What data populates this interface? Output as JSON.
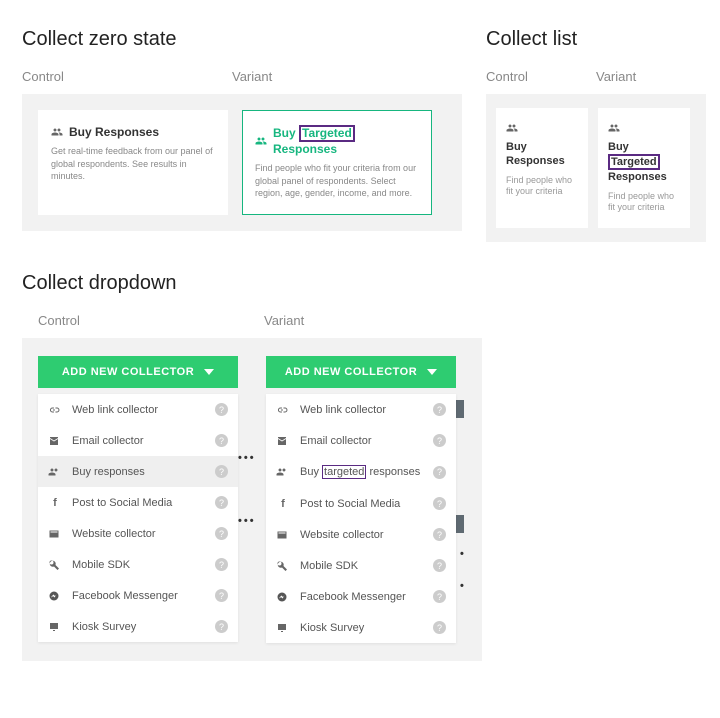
{
  "zero_state": {
    "title": "Collect zero state",
    "control_label": "Control",
    "variant_label": "Variant",
    "control": {
      "heading": "Buy Responses",
      "sub": "Get real-time feedback from our panel of global respondents. See results in minutes."
    },
    "variant": {
      "heading_pre": "Buy",
      "heading_hl": "Targeted",
      "heading_post": "Responses",
      "sub": "Find people who fit your criteria from our global panel of respondents. Select region, age, gender, income, and more."
    }
  },
  "collect_list": {
    "title": "Collect list",
    "control_label": "Control",
    "variant_label": "Variant",
    "control": {
      "heading": "Buy Responses",
      "sub": "Find people who fit your criteria"
    },
    "variant": {
      "heading_pre": "Buy",
      "heading_hl": "Targeted",
      "heading_post": "Responses",
      "sub": "Find people who fit your criteria"
    }
  },
  "dropdown": {
    "title": "Collect dropdown",
    "control_label": "Control",
    "variant_label": "Variant",
    "button": "ADD NEW COLLECTOR",
    "items": {
      "web_link": "Web link collector",
      "email": "Email collector",
      "buy_control": "Buy responses",
      "buy_variant_pre": "Buy",
      "buy_variant_hl": "targeted",
      "buy_variant_post": "responses",
      "social": "Post to Social Media",
      "website": "Website collector",
      "mobile": "Mobile SDK",
      "fb": "Facebook Messenger",
      "kiosk": "Kiosk Survey"
    }
  },
  "glyphs": {
    "people": "👥",
    "help": "?",
    "dots": "•••",
    "facebook_f": "f",
    "dot": "•"
  }
}
